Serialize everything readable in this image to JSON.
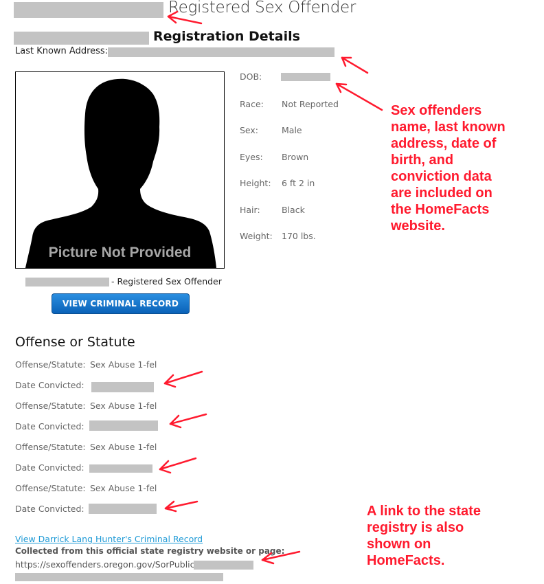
{
  "header": {
    "title": "Registered Sex Offender",
    "subtitle": "Registration Details",
    "address_label": "Last Known Address:"
  },
  "photo": {
    "caption": "Picture Not Provided",
    "name_suffix": "- Registered Sex Offender"
  },
  "buttons": {
    "view_record": "VIEW CRIMINAL RECORD"
  },
  "details": [
    {
      "label": "DOB:",
      "value": ""
    },
    {
      "label": "Race:",
      "value": "Not Reported"
    },
    {
      "label": "Sex:",
      "value": "Male"
    },
    {
      "label": "Eyes:",
      "value": "Brown"
    },
    {
      "label": "Height:",
      "value": "6 ft 2 in"
    },
    {
      "label": "Hair:",
      "value": "Black"
    },
    {
      "label": "Weight:",
      "value": "170 lbs."
    }
  ],
  "offenses": {
    "title": "Offense or Statute",
    "rows": [
      {
        "label": "Offense/Statute:",
        "value": "Sex Abuse 1-fel"
      },
      {
        "label": "Date Convicted:",
        "value": ""
      },
      {
        "label": "Offense/Statute:",
        "value": "Sex Abuse 1-fel"
      },
      {
        "label": "Date Convicted:",
        "value": ""
      },
      {
        "label": "Offense/Statute:",
        "value": "Sex Abuse 1-fel"
      },
      {
        "label": "Date Convicted:",
        "value": ""
      },
      {
        "label": "Offense/Statute:",
        "value": "Sex Abuse 1-fel"
      },
      {
        "label": "Date Convicted:",
        "value": ""
      }
    ]
  },
  "source": {
    "link_text": "View Darrick Lang Hunter's Criminal Record",
    "collected_text": "Collected from this official state registry website or page:",
    "url_text": "https://sexoffenders.oregon.gov/SorPublic/"
  },
  "annotations": {
    "top": "Sex offenders\nname, last known\naddress, date of\nbirth, and\nconviction data\nare included on\nthe HomeFacts\nwebsite.",
    "bottom": "A link to the state\nregistry is also\nshown on\nHomeFacts.",
    "color": "#ff1a2e"
  },
  "colors": {
    "button": "#1a78cc",
    "link": "#1e9ad6",
    "redaction": "#c3c3c3"
  }
}
